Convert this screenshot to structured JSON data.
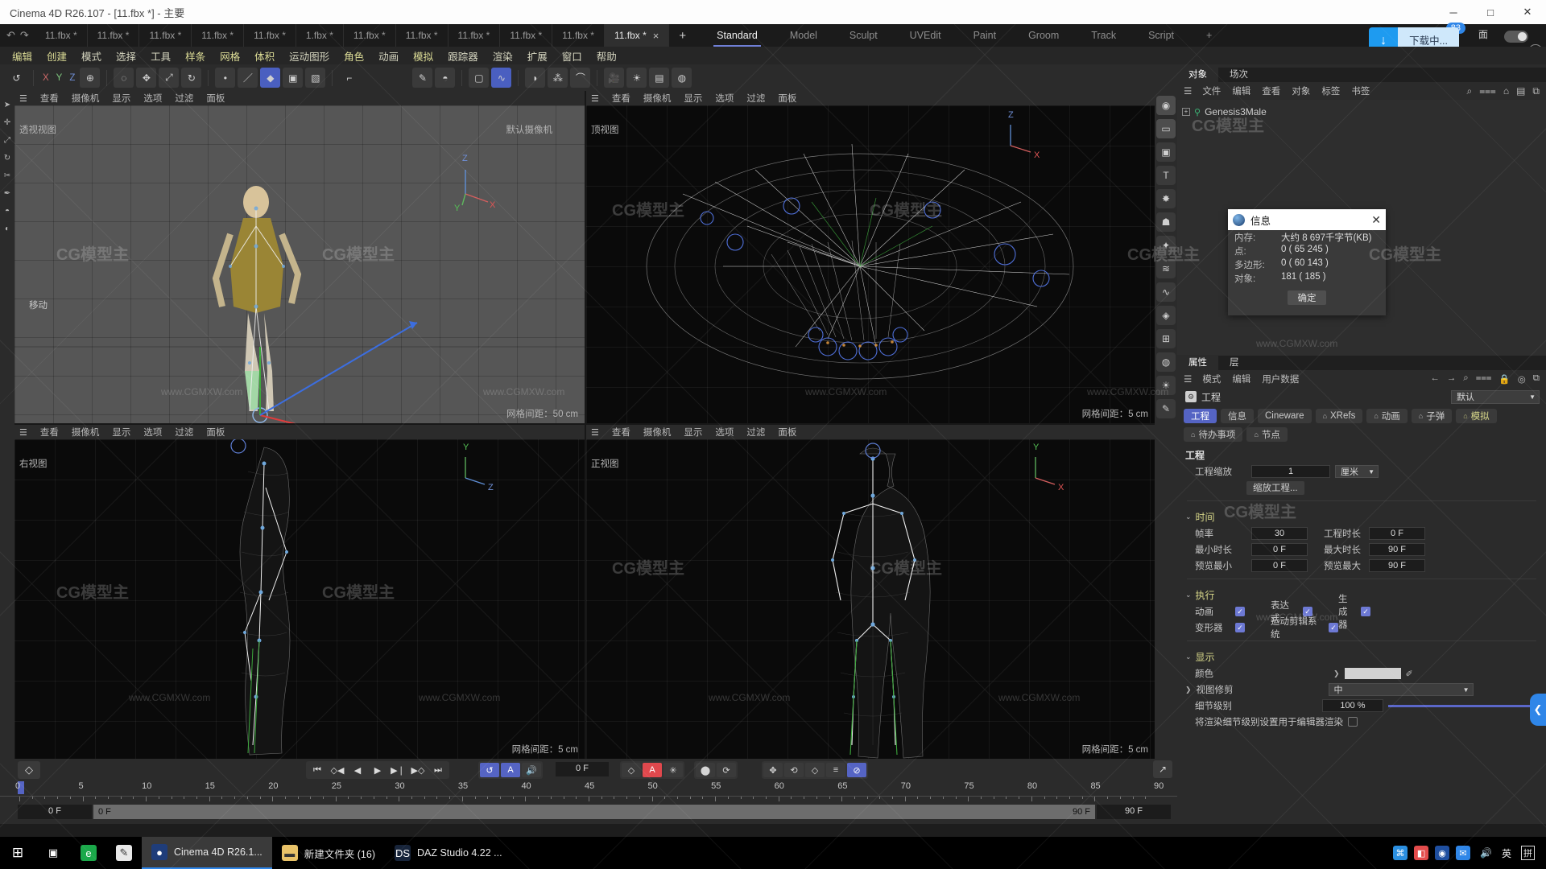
{
  "window": {
    "title": "Cinema 4D R26.107 - [11.fbx *] - 主要",
    "minimize": "─",
    "maximize": "□",
    "close": "✕"
  },
  "tabstrip": {
    "undo_icon": "↶",
    "redo_icon": "↷",
    "doc_tabs": [
      {
        "label": "11.fbx *",
        "active": false
      },
      {
        "label": "11.fbx *",
        "active": false
      },
      {
        "label": "11.fbx *",
        "active": false
      },
      {
        "label": "11.fbx *",
        "active": false
      },
      {
        "label": "11.fbx *",
        "active": false
      },
      {
        "label": "1.fbx *",
        "active": false
      },
      {
        "label": "11.fbx *",
        "active": false
      },
      {
        "label": "11.fbx *",
        "active": false
      },
      {
        "label": "11.fbx *",
        "active": false
      },
      {
        "label": "11.fbx *",
        "active": false
      },
      {
        "label": "11.fbx *",
        "active": false
      },
      {
        "label": "11.fbx *",
        "active": true
      }
    ],
    "close_glyph": "×",
    "add_tab": "+",
    "layout_tabs": [
      {
        "label": "Standard",
        "active": true
      },
      {
        "label": "Model",
        "active": false
      },
      {
        "label": "Sculpt",
        "active": false
      },
      {
        "label": "UVEdit",
        "active": false
      },
      {
        "label": "Paint",
        "active": false
      },
      {
        "label": "Groom",
        "active": false
      },
      {
        "label": "Track",
        "active": false
      },
      {
        "label": "Script",
        "active": false
      }
    ],
    "layout_plus": "+",
    "download_label": "下载中...",
    "download_arrow": "↓",
    "download_badge": "83",
    "mian_label": "面",
    "help": "?"
  },
  "menubar": {
    "items": [
      "编辑",
      "创建",
      "模式",
      "选择",
      "工具",
      "样条",
      "网格",
      "体积",
      "运动图形",
      "角色",
      "动画",
      "模拟",
      "跟踪器",
      "渲染",
      "扩展",
      "窗口",
      "帮助"
    ]
  },
  "toolbar": {
    "axis_x": "X",
    "axis_y": "Y",
    "axis_z": "Z",
    "icons": [
      "undo-icon",
      "redo-icon",
      "live-select-icon",
      "move-icon",
      "scale-icon",
      "rotate-icon",
      "axis-lock-icon",
      "world-coord-icon",
      "point-mode-icon",
      "edge-mode-icon",
      "polygon-mode-icon",
      "model-mode-icon",
      "texture-mode-icon",
      "workplane-icon",
      "cube-icon",
      "spline-icon",
      "nurbs-icon",
      "array-icon",
      "deformer-icon",
      "camera-icon",
      "light-icon",
      "floor-icon",
      "material-icon",
      "render-view-icon",
      "render-region-icon",
      "render-settings-icon",
      "content-browser-icon"
    ]
  },
  "viewports": {
    "menu": [
      "查看",
      "摄像机",
      "显示",
      "选项",
      "过滤",
      "面板"
    ],
    "panels": [
      {
        "name": "透视视图",
        "camera": "默认摄像机",
        "grid": "网格间距：50 cm",
        "tool_hint": "移动"
      },
      {
        "name": "顶视图",
        "camera": "",
        "grid": "网格间距：5 cm",
        "tool_hint": ""
      },
      {
        "name": "右视图",
        "camera": "",
        "grid": "网格间距：5 cm",
        "tool_hint": ""
      },
      {
        "name": "正视图",
        "camera": "",
        "grid": "网格间距：5 cm",
        "tool_hint": ""
      }
    ],
    "gnomon": {
      "x": "X",
      "y": "Y",
      "z": "Z"
    }
  },
  "object_manager": {
    "tabs": [
      {
        "label": "对象",
        "active": true
      },
      {
        "label": "场次",
        "active": false
      }
    ],
    "menus": [
      "文件",
      "编辑",
      "查看",
      "对象",
      "标签",
      "书签"
    ],
    "icons": [
      "search-icon",
      "filter-icon",
      "home-icon",
      "layers-icon",
      "expand-icon"
    ],
    "objects": [
      {
        "name": "Genesis3Male",
        "expand": "+",
        "icon": "joint-icon"
      }
    ]
  },
  "info_dialog": {
    "title": "信息",
    "close": "✕",
    "rows": [
      {
        "key": "内存:",
        "value": "大约 8 697千字节(KB)"
      },
      {
        "key": "点:",
        "value": "0 ( 65 245 )"
      },
      {
        "key": "多边形:",
        "value": "0 ( 60 143 )"
      },
      {
        "key": "对象:",
        "value": "181 ( 185 )"
      }
    ],
    "ok_button": "确定"
  },
  "attributes": {
    "tabs": [
      {
        "label": "属性",
        "active": true
      },
      {
        "label": "层",
        "active": false
      }
    ],
    "menus": [
      "模式",
      "编辑",
      "用户数据"
    ],
    "icons": [
      "back-arrow-icon",
      "search-icon",
      "filter-icon",
      "lock-icon",
      "target-icon",
      "popout-icon"
    ],
    "object_title": "工程",
    "preset": "默认",
    "tab_chips": [
      {
        "label": "工程",
        "active": true,
        "bell": false,
        "yellow": false
      },
      {
        "label": "信息",
        "active": false,
        "bell": false,
        "yellow": false
      },
      {
        "label": "Cineware",
        "active": false,
        "bell": false,
        "yellow": false
      },
      {
        "label": "XRefs",
        "active": false,
        "bell": true,
        "yellow": false
      },
      {
        "label": "动画",
        "active": false,
        "bell": true,
        "yellow": false
      },
      {
        "label": "子弹",
        "active": false,
        "bell": true,
        "yellow": false
      },
      {
        "label": "模拟",
        "active": false,
        "bell": true,
        "yellow": true
      },
      {
        "label": "待办事项",
        "active": false,
        "bell": true,
        "yellow": false
      },
      {
        "label": "节点",
        "active": false,
        "bell": true,
        "yellow": false
      }
    ],
    "project": {
      "heading": "工程",
      "scale_label": "工程缩放",
      "scale_value": "1",
      "scale_unit": "厘米",
      "scale_button": "缩放工程..."
    },
    "time": {
      "heading": "时间",
      "fps_label": "帧率",
      "fps_value": "30",
      "duration_label": "工程时长",
      "duration_value": "0 F",
      "min_label": "最小时长",
      "min_value": "0 F",
      "max_label": "最大时长",
      "max_value": "90 F",
      "pmin_label": "预览最小",
      "pmin_value": "0 F",
      "pmax_label": "预览最大",
      "pmax_value": "90 F"
    },
    "execute": {
      "heading": "执行",
      "items": [
        {
          "label": "动画",
          "checked": true
        },
        {
          "label": "表达式",
          "checked": true
        },
        {
          "label": "生成器",
          "checked": true
        },
        {
          "label": "变形器",
          "checked": true
        },
        {
          "label": "运动剪辑系统",
          "checked": true
        }
      ]
    },
    "display": {
      "heading": "显示",
      "color_label": "颜色",
      "clip_label": "视图修剪",
      "clip_value": "中",
      "lod_label": "细节级别",
      "lod_value": "100 %",
      "render_lod_label": "将渲染细节级别设置用于编辑器渲染",
      "render_lod_checked": false
    }
  },
  "timeline": {
    "key_icon": "◇",
    "transport": [
      "⏮",
      "◇◀",
      "◀",
      "▶",
      "▶❘",
      "▶◇",
      "⏭"
    ],
    "loop_icon": "↺",
    "autokey_icon": "A",
    "sound_icon": "🔊",
    "current_frame": "0 F",
    "record_group": [
      "◇",
      "A",
      "✳"
    ],
    "pos_group": [
      "⬤",
      "⥁"
    ],
    "axis_group": [
      "✥",
      "↻",
      "◇",
      "≡",
      "✕"
    ],
    "corner_icon": "↗",
    "ruler_ticks": [
      "0",
      "5",
      "10",
      "15",
      "20",
      "25",
      "30",
      "35",
      "40",
      "45",
      "50",
      "55",
      "60",
      "65",
      "70",
      "75",
      "80",
      "85",
      "90"
    ],
    "left_field": "0 F",
    "left_field2": "0 F",
    "right_bar_label": "90 F",
    "right_field": "90 F"
  },
  "taskbar": {
    "start_icon": "⊞",
    "search_icon": "▣",
    "items": [
      {
        "label": "",
        "icon": "edge-icon",
        "active": false,
        "iconbg": "#1ba84a",
        "glyph": "e"
      },
      {
        "label": "",
        "icon": "paint-icon",
        "active": false,
        "iconbg": "#e8e8e8",
        "glyph": "✎"
      },
      {
        "label": "Cinema 4D R26.1...",
        "icon": "cinema4d-icon",
        "active": true,
        "iconbg": "#1f3d7a",
        "glyph": "●"
      },
      {
        "label": "新建文件夹 (16)",
        "icon": "folder-icon",
        "active": false,
        "iconbg": "#e8c268",
        "glyph": "▬"
      },
      {
        "label": "DAZ Studio 4.22 ...",
        "icon": "daz-icon",
        "active": false,
        "iconbg": "#17243a",
        "glyph": "DS"
      }
    ],
    "tray": [
      {
        "name": "app-icon-1",
        "glyph": "⌘",
        "bg": "#2b8fe0"
      },
      {
        "name": "app-icon-2",
        "glyph": "◧",
        "bg": "#e24b4b"
      },
      {
        "name": "app-icon-3",
        "glyph": "◉",
        "bg": "#1f4fa0"
      },
      {
        "name": "app-icon-4",
        "glyph": "✉",
        "bg": "#2f86e8"
      }
    ],
    "volume_icon": "🔊",
    "lang": "英",
    "ime": "拼"
  },
  "watermarks": {
    "brand": "CG模型主",
    "url": "www.CGMXW.com"
  }
}
